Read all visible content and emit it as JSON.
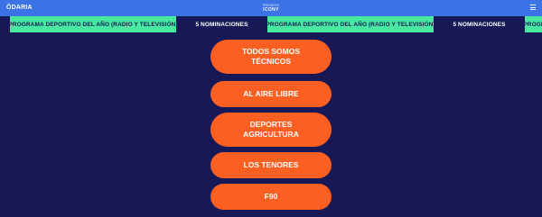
{
  "header": {
    "brand": "ÖDARIA",
    "center_logo_line1": "PREMIOS",
    "center_logo_line2": "ICONY"
  },
  "ticker": {
    "items": [
      "PROGRAMA DEPORTIVO DEL AÑO (RADIO Y TELEVISIÓN)",
      "5 NOMINACIONES",
      "PROGRAMA DEPORTIVO DEL AÑO (RADIO Y TELEVISIÓN)",
      "5 NOMINACIONES",
      "PROGRAMA DEPORTIVO DEL AÑO (RADIO Y TELEVISIÓN)"
    ]
  },
  "nominees": [
    "TODOS SOMOS TÉCNICOS",
    "AL AIRE LIBRE",
    "DEPORTES AGRICULTURA",
    "LOS TENORES",
    "F90"
  ],
  "colors": {
    "background": "#161956",
    "topbar": "#3b73e6",
    "ticker_green": "#47e8a0",
    "button": "#fb5f22"
  }
}
